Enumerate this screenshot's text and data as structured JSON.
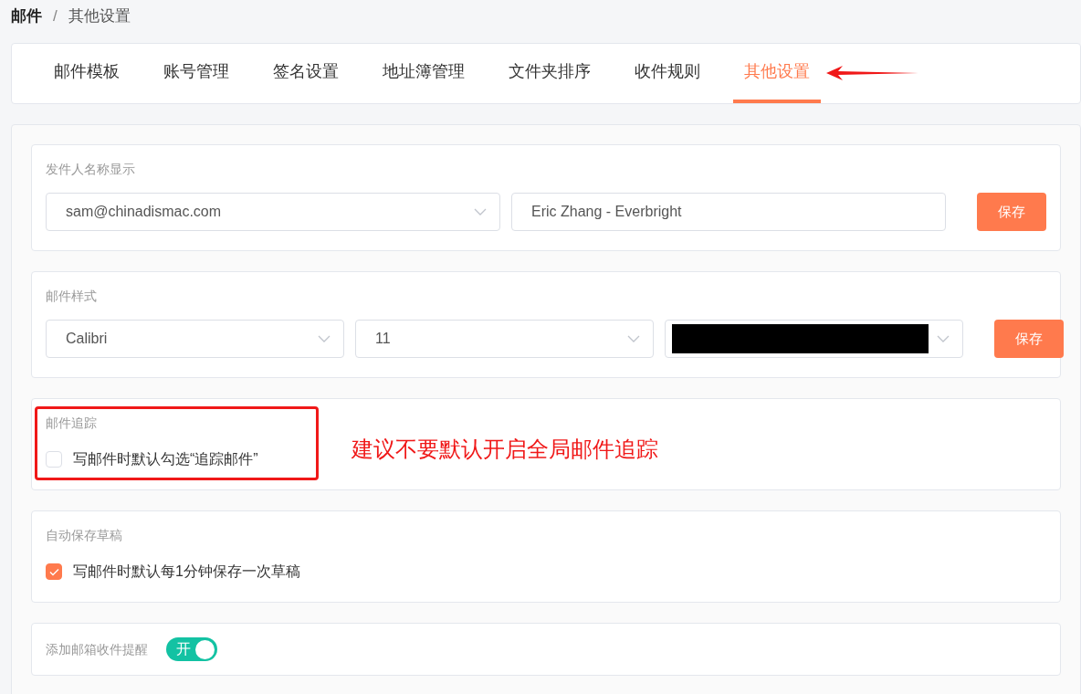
{
  "breadcrumb": [
    {
      "label": "邮件"
    },
    {
      "label": "其他设置"
    }
  ],
  "breadcrumb_separator": "/",
  "tabs": [
    {
      "label": "邮件模板",
      "selected": false
    },
    {
      "label": "账号管理",
      "selected": false
    },
    {
      "label": "签名设置",
      "selected": false
    },
    {
      "label": "地址簿管理",
      "selected": false
    },
    {
      "label": "文件夹排序",
      "selected": false
    },
    {
      "label": "收件规则",
      "selected": false
    },
    {
      "label": "其他设置",
      "selected": true
    }
  ],
  "sections": [
    {
      "kind": "sender",
      "title": "发件人名称显示",
      "select": {
        "value": "sam@chinadismac.com"
      },
      "input": {
        "value": "Eric Zhang - Everbright"
      },
      "button": "保存"
    },
    {
      "kind": "style",
      "title": "邮件样式",
      "selects": [
        {
          "value": "Calibri",
          "redacted": false
        },
        {
          "value": "11",
          "redacted": false
        },
        {
          "redacted": true
        }
      ],
      "button": "保存"
    },
    {
      "kind": "checkbox",
      "title": "邮件追踪",
      "label": "写邮件时默认勾选“追踪邮件”",
      "checked": false
    },
    {
      "kind": "checkbox",
      "title": "自动保存草稿",
      "label": "写邮件时默认每1分钟保存一次草稿",
      "checked": true
    },
    {
      "kind": "switch",
      "title": "添加邮箱收件提醒",
      "switch_label": "开",
      "on": true
    }
  ],
  "annotation": {
    "text": "建议不要默认开启全局邮件追踪"
  }
}
